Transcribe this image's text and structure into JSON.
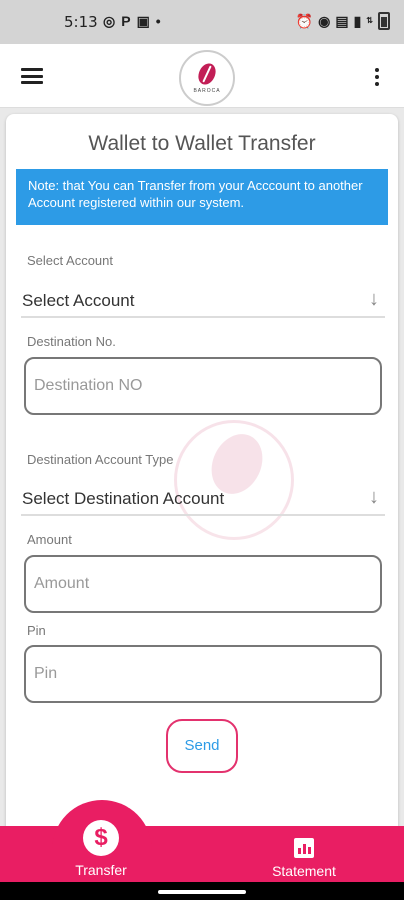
{
  "status_bar": {
    "time": "5:13",
    "icons": [
      "whatsapp-icon",
      "parking-icon",
      "news-icon",
      "dot-icon"
    ],
    "right_icons": [
      "alarm-icon",
      "hotspot-icon",
      "wifi-icon",
      "signal-icon",
      "data-speed-icon",
      "battery-icon"
    ]
  },
  "app_bar": {
    "logo_text": "BAROCA"
  },
  "form": {
    "title": "Wallet to Wallet Transfer",
    "note": "Note: that You can Transfer from your Acccount to another Account registered within our system.",
    "select_account_label": "Select Account",
    "select_account_value": "Select Account",
    "destination_no_label": "Destination No.",
    "destination_no_placeholder": "Destination NO",
    "destination_type_label": "Destination Account Type",
    "destination_type_value": "Select Destination Account",
    "amount_label": "Amount",
    "amount_placeholder": "Amount",
    "pin_label": "Pin",
    "pin_placeholder": "Pin",
    "send_label": "Send"
  },
  "bottom_nav": {
    "transfer_label": "Transfer",
    "statement_label": "Statement",
    "active": "Transfer"
  },
  "colors": {
    "accent": "#e91e63",
    "note_bg": "#2d9be6",
    "send_text": "#2d9be6"
  }
}
